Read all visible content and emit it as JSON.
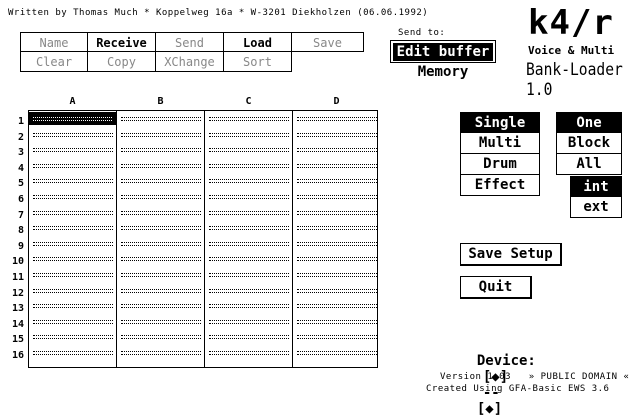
{
  "header": {
    "author_line": "Written by Thomas Much * Koppelweg 16a * W-3201 Diekholzen  (06.06.1992)"
  },
  "file_menu": {
    "row1": [
      {
        "label": "Name",
        "state": "dim"
      },
      {
        "label": "Receive",
        "state": "bold"
      },
      {
        "label": "Send",
        "state": "dim"
      },
      {
        "label": "Load",
        "state": "bold"
      },
      {
        "label": "Save",
        "state": "dim"
      }
    ],
    "row2": [
      {
        "label": "Clear",
        "state": "dim"
      },
      {
        "label": "Copy",
        "state": "dim"
      },
      {
        "label": "XChange",
        "state": "dim"
      },
      {
        "label": "Sort",
        "state": "dim"
      }
    ]
  },
  "send_to": {
    "label": "Send to:",
    "options": [
      {
        "label": "Edit buffer",
        "selected": true
      },
      {
        "label": "Memory",
        "selected": false
      }
    ]
  },
  "logo": {
    "title": "k4/r",
    "subtitle": "Voice & Multi",
    "product": "Bank-Loader 1.0"
  },
  "bank_grid": {
    "columns": [
      "A",
      "B",
      "C",
      "D"
    ],
    "rows": [
      "1",
      "2",
      "3",
      "4",
      "5",
      "6",
      "7",
      "8",
      "9",
      "10",
      "11",
      "12",
      "13",
      "14",
      "15",
      "16"
    ],
    "selected": {
      "column": "A",
      "row": "1"
    }
  },
  "type_select": {
    "options": [
      {
        "label": "Single",
        "selected": true
      },
      {
        "label": "Multi",
        "selected": false
      },
      {
        "label": "Drum",
        "selected": false
      },
      {
        "label": "Effect",
        "selected": false
      }
    ]
  },
  "range_select": {
    "options": [
      {
        "label": "One",
        "selected": true
      },
      {
        "label": "Block",
        "selected": false
      },
      {
        "label": "All",
        "selected": false
      }
    ]
  },
  "memory_select": {
    "options": [
      {
        "label": "int",
        "selected": true
      },
      {
        "label": "ext",
        "selected": false
      }
    ]
  },
  "actions": {
    "save_setup": "Save Setup",
    "quit": "Quit"
  },
  "device": {
    "label": "Device:",
    "dec": "[◆]",
    "value": "--",
    "inc": "[◆]"
  },
  "footer": {
    "version": "Version 1.03   » PUBLIC DOMAIN «",
    "created": "Created Using GFA-Basic EWS 3.6"
  }
}
